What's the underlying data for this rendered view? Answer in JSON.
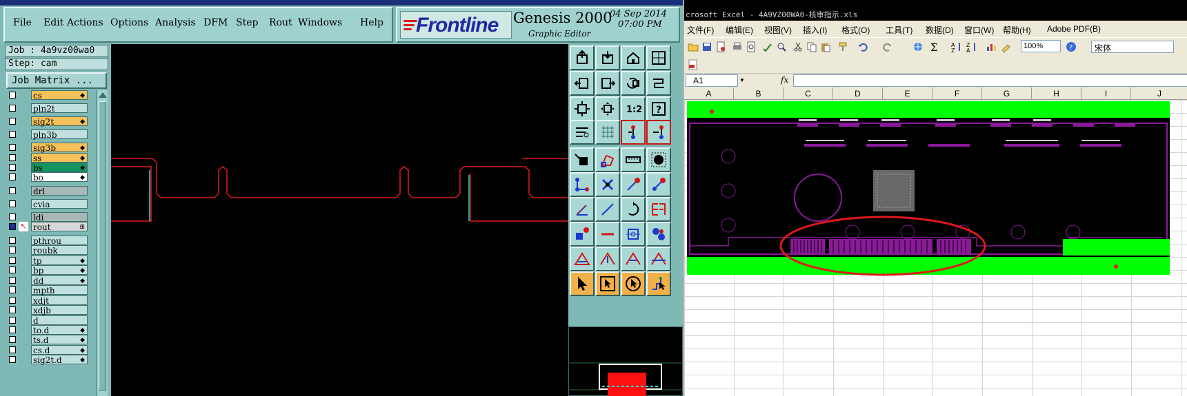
{
  "genesis": {
    "menu": [
      "File",
      "Edit",
      "Actions",
      "Options",
      "Analysis",
      "DFM",
      "Step",
      "Rout",
      "Windows",
      "Help"
    ],
    "brand": "Frontline",
    "product": "Genesis 2000",
    "subtitle": "Graphic Editor",
    "date": "04 Sep 2014",
    "time": "07:00 PM",
    "job_label": "Job : 4a9vz00wa0",
    "step_label": "Step: cam",
    "job_matrix_button": "Job Matrix ...",
    "layers": [
      {
        "name": "cs",
        "color": "#f5c15a",
        "flag": "◆"
      },
      {
        "name": "pln2t",
        "color": "#bfe0de",
        "flag": ""
      },
      {
        "name": "sig2t",
        "color": "#f5c15a",
        "flag": "◆"
      },
      {
        "name": "pln3b",
        "color": "#bfe0de",
        "flag": ""
      },
      {
        "name": "sig3b",
        "color": "#f5c15a",
        "flag": "◆"
      },
      {
        "name": "ss",
        "color": "#f5c15a",
        "flag": "◆"
      },
      {
        "name": "bs",
        "color": "#14955f",
        "flag": "◆"
      },
      {
        "name": "bo",
        "color": "#ffffff",
        "flag": "◆"
      },
      {
        "name": "drl",
        "color": "#a8b8b7",
        "flag": ""
      },
      {
        "name": "cvia",
        "color": "#bfe0de",
        "flag": ""
      },
      {
        "name": "ldi",
        "color": "#a8b8b7",
        "flag": ""
      },
      {
        "name": "rout",
        "color": "#d8d8d8",
        "flag": "⊞"
      },
      {
        "name": "pthrou",
        "color": "#bfe0de",
        "flag": ""
      },
      {
        "name": "roubk",
        "color": "#bfe0de",
        "flag": ""
      },
      {
        "name": "tp",
        "color": "#bfe0de",
        "flag": "◆"
      },
      {
        "name": "bp",
        "color": "#bfe0de",
        "flag": "◆"
      },
      {
        "name": "dd",
        "color": "#bfe0de",
        "flag": "◆"
      },
      {
        "name": "mpth",
        "color": "#bfe0de",
        "flag": ""
      },
      {
        "name": "xdjt",
        "color": "#bfe0de",
        "flag": ""
      },
      {
        "name": "xdjb",
        "color": "#bfe0de",
        "flag": ""
      },
      {
        "name": "d",
        "color": "#bfe0de",
        "flag": ""
      },
      {
        "name": "to.d",
        "color": "#bfe0de",
        "flag": "◆"
      },
      {
        "name": "ts.d",
        "color": "#bfe0de",
        "flag": "◆"
      },
      {
        "name": "cs.d",
        "color": "#bfe0de",
        "flag": "◆"
      },
      {
        "name": "sig2t.d",
        "color": "#bfe0de",
        "flag": "◆"
      }
    ],
    "tools": [
      "open-icon",
      "save-icon",
      "home-icon",
      "grid-window-icon",
      "move-left-icon",
      "move-right-icon",
      "zoom-back-icon",
      "route-icon",
      "fit-icon",
      "center-icon",
      "ratio-icon",
      "help-icon",
      "measure-tool-icon",
      "snap-grid-icon",
      "net-a-icon",
      "net-b-icon",
      "pad-icon",
      "polygon-icon",
      "ruler-icon",
      "dot-icon",
      "connect-icon",
      "cross-icon",
      "line-dot-icon",
      "arc-dot-icon",
      "angle-icon",
      "slash-icon",
      "rotate-icon",
      "split-icon",
      "pad-select-icon",
      "line-icon",
      "symbol-icon",
      "multi-pad-icon",
      "triangle-a-icon",
      "triangle-b-icon",
      "triangle-c-icon",
      "triangle-d-icon",
      "pointer-icon",
      "pointer-box-icon",
      "pointer-circle-icon",
      "pointer-route-icon"
    ],
    "colors": {
      "panel": "#7fb9b6",
      "trace": "#e01818",
      "outline": "#39d4d4"
    }
  },
  "excel": {
    "title": "crosoft Excel - 4A9VZ00WA0-核审指示.xls",
    "menu": [
      "文件(F)",
      "编辑(E)",
      "视图(V)",
      "插入(I)",
      "格式(O)",
      "工具(T)",
      "数据(D)",
      "窗口(W)",
      "帮助(H)",
      "Adobe PDF(B)"
    ],
    "zoom": "100%",
    "font": "宋体",
    "name_box": "A1",
    "fx": "fx",
    "columns": [
      "A",
      "B",
      "C",
      "D",
      "E",
      "F",
      "G",
      "H",
      "I",
      "J"
    ],
    "colors": {
      "pcb_green": "#00ff00",
      "pcb_purple": "#8a1a9a",
      "highlight": "#e01818"
    }
  }
}
